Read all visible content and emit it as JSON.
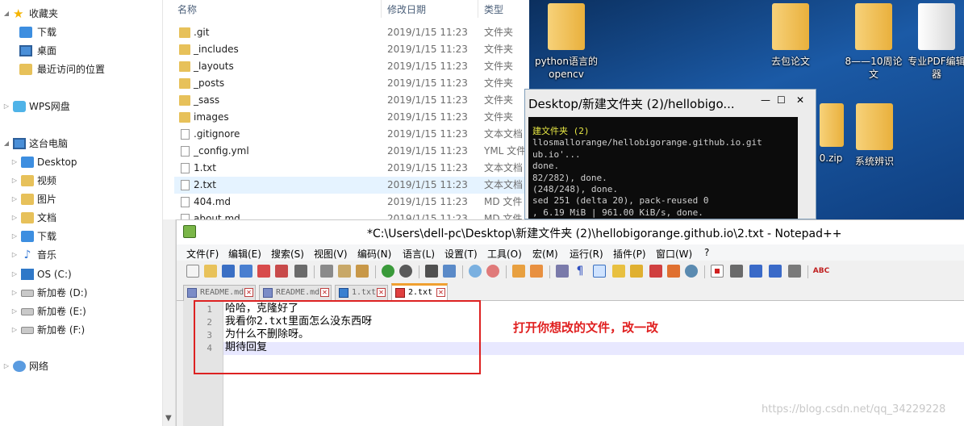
{
  "nav": {
    "favorites": "收藏夹",
    "downloads": "下载",
    "desktop": "桌面",
    "recent": "最近访问的位置",
    "wps": "WPS网盘",
    "this_pc": "这台电脑",
    "pc_items": [
      "Desktop",
      "视频",
      "图片",
      "文档",
      "下载",
      "音乐",
      "OS (C:)",
      "新加卷 (D:)",
      "新加卷 (E:)",
      "新加卷 (F:)"
    ],
    "network": "网络"
  },
  "file_list": {
    "col_name": "名称",
    "col_date": "修改日期",
    "col_type": "类型",
    "rows": [
      {
        "name": ".git",
        "date": "2019/1/15 11:23",
        "type": "文件夹",
        "icon": "folder"
      },
      {
        "name": "_includes",
        "date": "2019/1/15 11:23",
        "type": "文件夹",
        "icon": "folder"
      },
      {
        "name": "_layouts",
        "date": "2019/1/15 11:23",
        "type": "文件夹",
        "icon": "folder"
      },
      {
        "name": "_posts",
        "date": "2019/1/15 11:23",
        "type": "文件夹",
        "icon": "folder"
      },
      {
        "name": "_sass",
        "date": "2019/1/15 11:23",
        "type": "文件夹",
        "icon": "folder"
      },
      {
        "name": "images",
        "date": "2019/1/15 11:23",
        "type": "文件夹",
        "icon": "folder"
      },
      {
        "name": ".gitignore",
        "date": "2019/1/15 11:23",
        "type": "文本文档",
        "icon": "doc"
      },
      {
        "name": "_config.yml",
        "date": "2019/1/15 11:23",
        "type": "YML 文件",
        "icon": "doc"
      },
      {
        "name": "1.txt",
        "date": "2019/1/15 11:23",
        "type": "文本文档",
        "icon": "doc"
      },
      {
        "name": "2.txt",
        "date": "2019/1/15 11:23",
        "type": "文本文档",
        "icon": "doc"
      },
      {
        "name": "404.md",
        "date": "2019/1/15 11:23",
        "type": "MD 文件",
        "icon": "doc"
      },
      {
        "name": "about.md",
        "date": "2019/1/15 11:23",
        "type": "MD 文件",
        "icon": "doc"
      }
    ]
  },
  "desktop_icons": {
    "python": "python语言的opencv",
    "paper": "去包论文",
    "eight": "8——10周论文",
    "pdf": "专业PDF编辑器",
    "zip": "0.zip",
    "sys": "系统辨识"
  },
  "cmd": {
    "title": "Desktop/新建文件夹 (2)/hellobigo...",
    "lines": [
      "建文件夹 (2)",
      "llosmallorange/hellobigorange.github.io.git",
      "ub.io'...",
      " done.",
      "82/282), done.",
      " (248/248), done.",
      "sed 251 (delta 20), pack-reused 0",
      ", 6.19 MiB | 961.00 KiB/s, done."
    ],
    "min": "—",
    "max": "☐",
    "close": "✕"
  },
  "npp": {
    "title": "*C:\\Users\\dell-pc\\Desktop\\新建文件夹 (2)\\hellobigorange.github.io\\2.txt - Notepad++",
    "menu": [
      "文件(F)",
      "编辑(E)",
      "搜索(S)",
      "视图(V)",
      "编码(N)",
      "语言(L)",
      "设置(T)",
      "工具(O)",
      "宏(M)",
      "运行(R)",
      "插件(P)",
      "窗口(W)",
      "?"
    ],
    "tabs": [
      "README.md",
      "README.md",
      "1.txt",
      "2.txt"
    ],
    "lines": [
      {
        "n": "1",
        "text": "哈哈，克隆好了"
      },
      {
        "n": "2",
        "text": "我看你2.txt里面怎么没东西呀"
      },
      {
        "n": "3",
        "text": "为什么不删除呀。"
      },
      {
        "n": "4",
        "text": "期待回复"
      }
    ]
  },
  "annotation": "打开你想改的文件，改一改",
  "watermark": "https://blog.csdn.net/qq_34229228"
}
